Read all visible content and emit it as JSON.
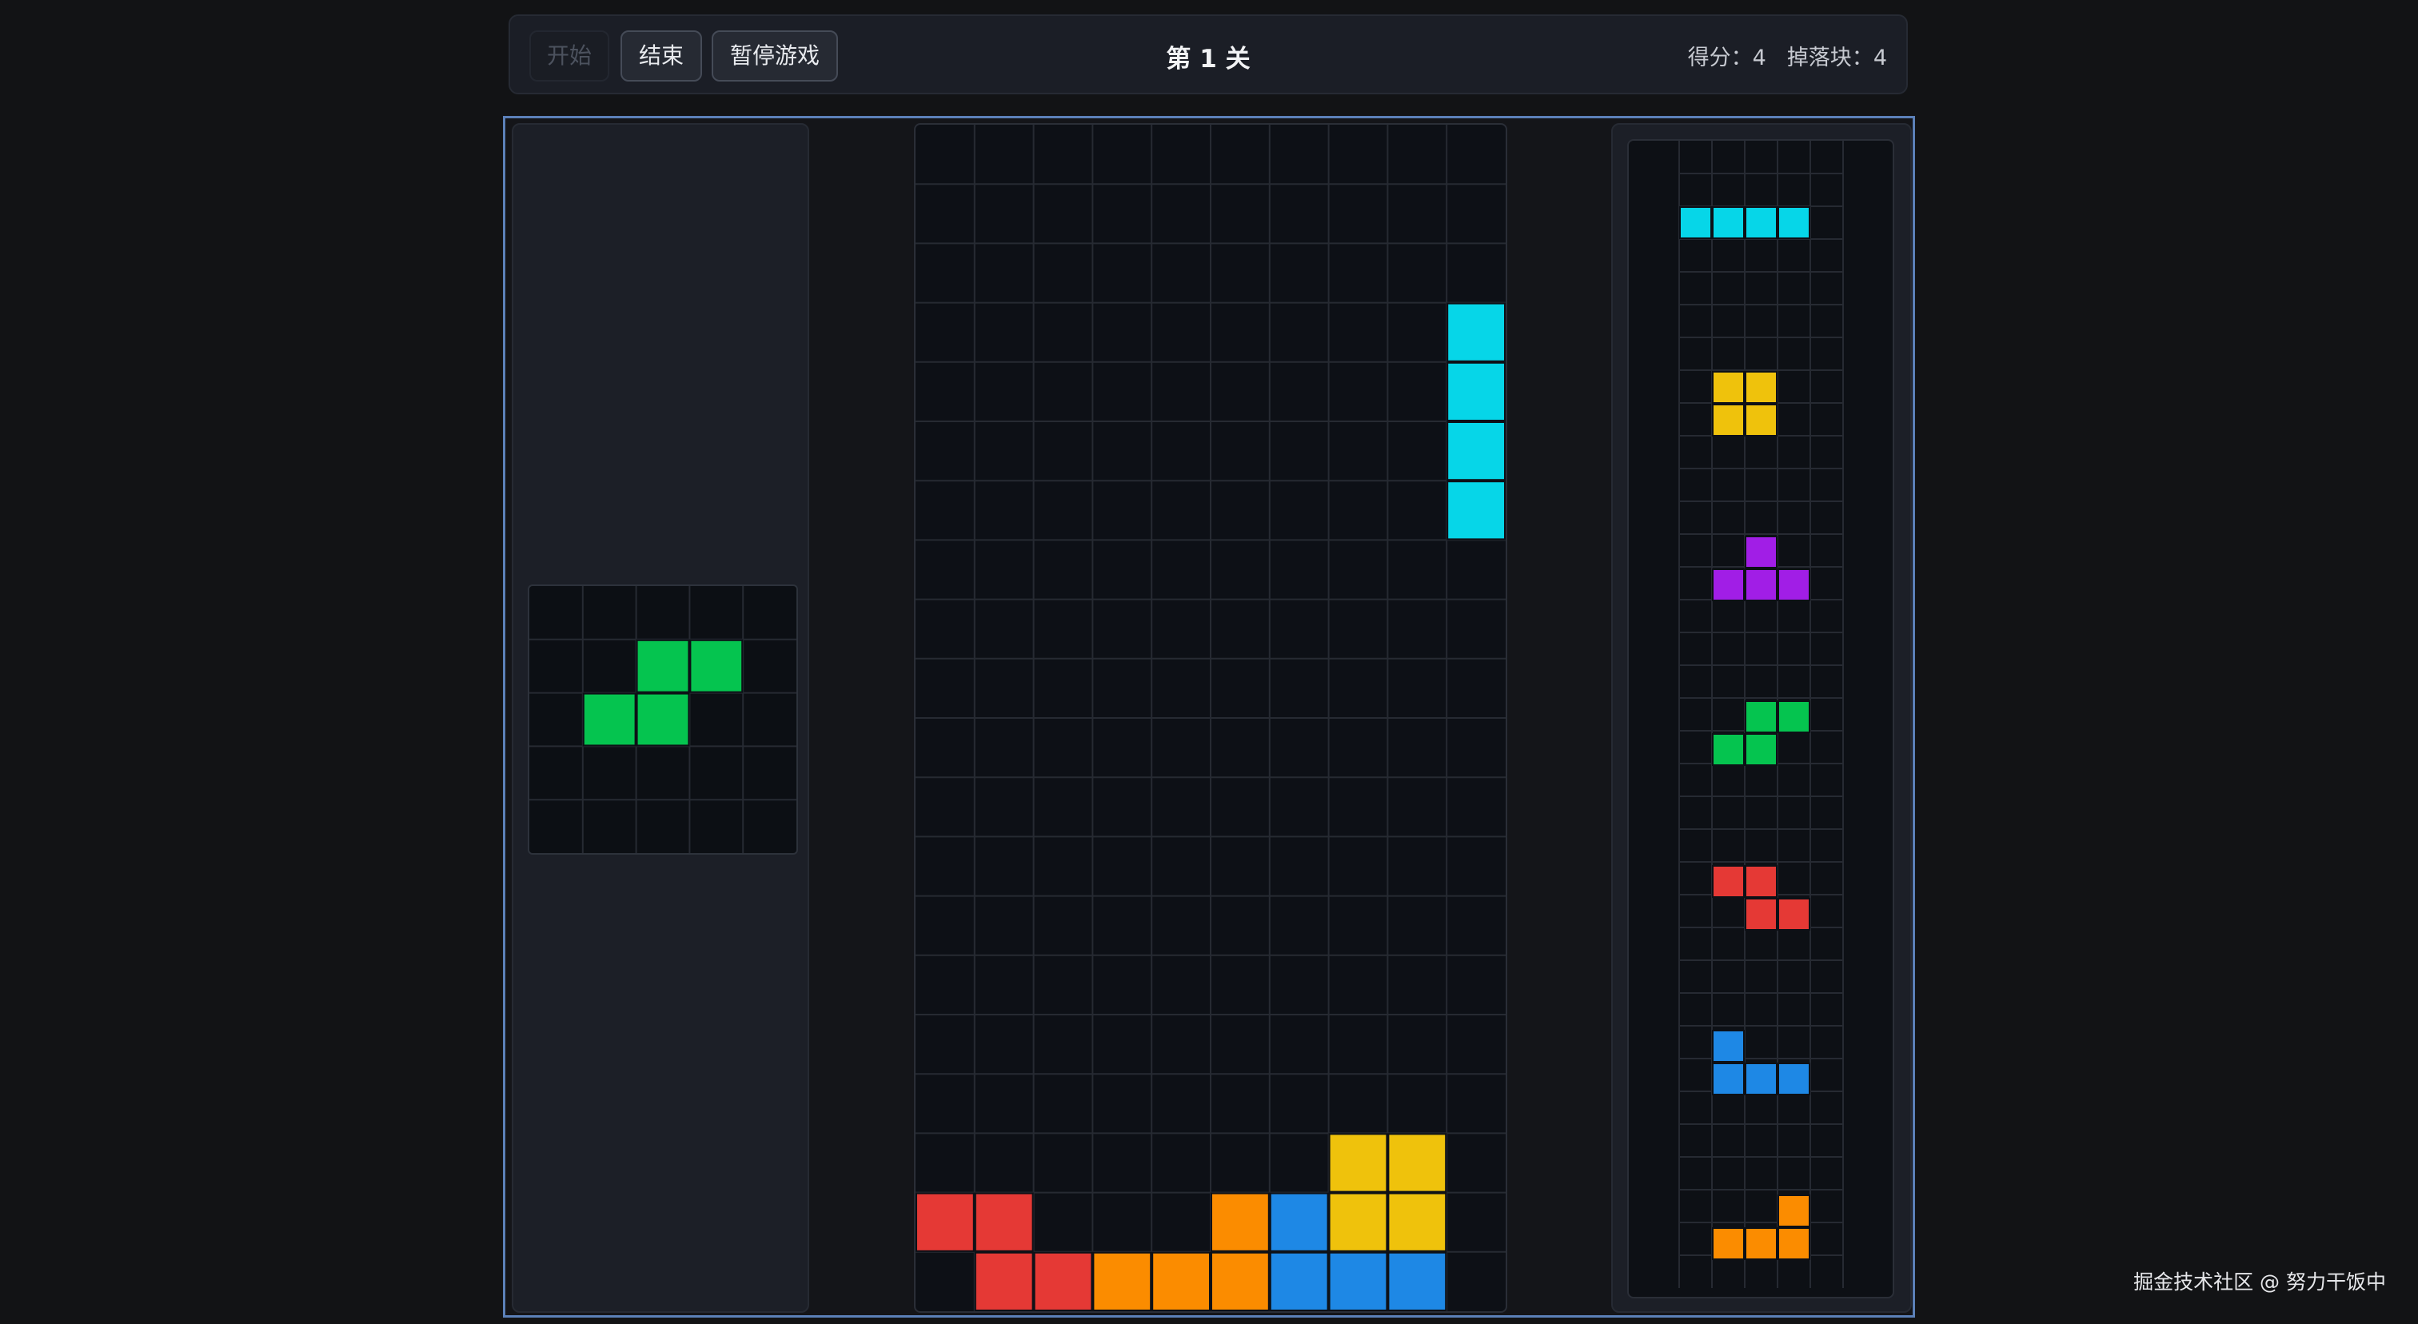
{
  "toolbar": {
    "start_label": "开始",
    "end_label": "结束",
    "pause_label": "暂停游戏",
    "level_label": "第 1 关",
    "score_label": "得分：",
    "score_value": "4",
    "dropped_label": "掉落块：",
    "dropped_value": "4"
  },
  "colors": {
    "cyan": "#06d6e8",
    "yellow": "#efc20c",
    "purple": "#a11ee6",
    "green": "#05c44f",
    "red": "#e53935",
    "blue": "#1e88e5",
    "orange": "#fb8c00"
  },
  "hold": {
    "piece": "S",
    "color": "green",
    "cells": [
      [
        1,
        2
      ],
      [
        1,
        3
      ],
      [
        2,
        1
      ],
      [
        2,
        2
      ]
    ]
  },
  "board": {
    "cols": 10,
    "rows": 20,
    "filled": [
      {
        "r": 3,
        "c": 9,
        "color": "cyan"
      },
      {
        "r": 4,
        "c": 9,
        "color": "cyan"
      },
      {
        "r": 5,
        "c": 9,
        "color": "cyan"
      },
      {
        "r": 6,
        "c": 9,
        "color": "cyan"
      },
      {
        "r": 17,
        "c": 7,
        "color": "yellow"
      },
      {
        "r": 17,
        "c": 8,
        "color": "yellow"
      },
      {
        "r": 18,
        "c": 0,
        "color": "red"
      },
      {
        "r": 18,
        "c": 1,
        "color": "red"
      },
      {
        "r": 18,
        "c": 5,
        "color": "orange"
      },
      {
        "r": 18,
        "c": 6,
        "color": "blue"
      },
      {
        "r": 18,
        "c": 7,
        "color": "yellow"
      },
      {
        "r": 18,
        "c": 8,
        "color": "yellow"
      },
      {
        "r": 19,
        "c": 1,
        "color": "red"
      },
      {
        "r": 19,
        "c": 2,
        "color": "red"
      },
      {
        "r": 19,
        "c": 3,
        "color": "orange"
      },
      {
        "r": 19,
        "c": 4,
        "color": "orange"
      },
      {
        "r": 19,
        "c": 5,
        "color": "orange"
      },
      {
        "r": 19,
        "c": 6,
        "color": "blue"
      },
      {
        "r": 19,
        "c": 7,
        "color": "blue"
      },
      {
        "r": 19,
        "c": 8,
        "color": "blue"
      }
    ]
  },
  "next_queue": [
    {
      "piece": "I",
      "color": "cyan",
      "cells": [
        [
          0,
          0
        ],
        [
          0,
          1
        ],
        [
          0,
          2
        ],
        [
          0,
          3
        ]
      ]
    },
    {
      "piece": "O",
      "color": "yellow",
      "cells": [
        [
          0,
          1
        ],
        [
          0,
          2
        ],
        [
          1,
          1
        ],
        [
          1,
          2
        ]
      ]
    },
    {
      "piece": "T",
      "color": "purple",
      "cells": [
        [
          0,
          2
        ],
        [
          1,
          1
        ],
        [
          1,
          2
        ],
        [
          1,
          3
        ]
      ]
    },
    {
      "piece": "S",
      "color": "green",
      "cells": [
        [
          0,
          2
        ],
        [
          0,
          3
        ],
        [
          1,
          1
        ],
        [
          1,
          2
        ]
      ]
    },
    {
      "piece": "Z",
      "color": "red",
      "cells": [
        [
          0,
          1
        ],
        [
          0,
          2
        ],
        [
          1,
          2
        ],
        [
          1,
          3
        ]
      ]
    },
    {
      "piece": "J",
      "color": "blue",
      "cells": [
        [
          0,
          1
        ],
        [
          1,
          1
        ],
        [
          1,
          2
        ],
        [
          1,
          3
        ]
      ]
    },
    {
      "piece": "L",
      "color": "orange",
      "cells": [
        [
          0,
          3
        ],
        [
          1,
          1
        ],
        [
          1,
          2
        ],
        [
          1,
          3
        ]
      ]
    }
  ],
  "watermark": "掘金技术社区 @ 努力干饭中"
}
